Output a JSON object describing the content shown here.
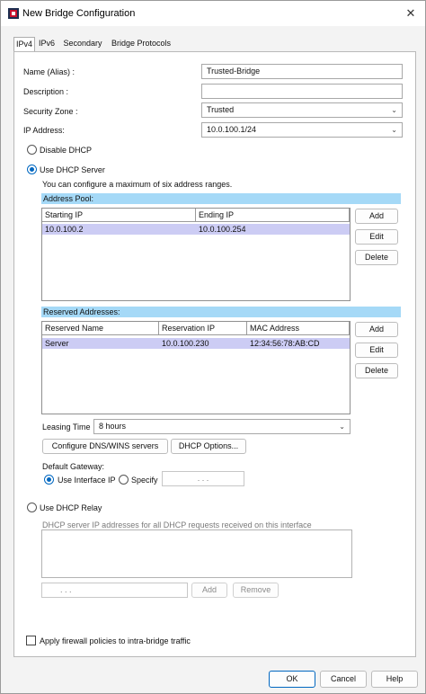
{
  "window": {
    "title": "New Bridge Configuration",
    "close_glyph": "✕"
  },
  "tabs": [
    {
      "label": "IPv4",
      "active": true
    },
    {
      "label": "IPv6",
      "active": false
    },
    {
      "label": "Secondary",
      "active": false
    },
    {
      "label": "Bridge Protocols",
      "active": false
    }
  ],
  "form": {
    "name_label": "Name (Alias) :",
    "name_value": "Trusted-Bridge",
    "description_label": "Description :",
    "description_value": "",
    "zone_label": "Security Zone :",
    "zone_value": "Trusted",
    "ip_label": "IP Address:",
    "ip_value": "10.0.100.1/24"
  },
  "dhcp": {
    "disable_label": "Disable DHCP",
    "server_label": "Use DHCP Server",
    "server_note": "You can configure a maximum of six address ranges.",
    "selected_mode": "server"
  },
  "address_pool": {
    "header": "Address Pool:",
    "columns": [
      "Starting IP",
      "Ending IP"
    ],
    "rows": [
      {
        "start": "10.0.100.2",
        "end": "10.0.100.254"
      }
    ],
    "add_label": "Add",
    "edit_label": "Edit",
    "delete_label": "Delete"
  },
  "reserved": {
    "header": "Reserved Addresses:",
    "columns": [
      "Reserved Name",
      "Reservation IP",
      "MAC Address"
    ],
    "rows": [
      {
        "name": "Server",
        "ip": "10.0.100.230",
        "mac": "12:34:56:78:AB:CD"
      }
    ],
    "add_label": "Add",
    "edit_label": "Edit",
    "delete_label": "Delete"
  },
  "leasing": {
    "label": "Leasing Time",
    "value": "8 hours"
  },
  "config_buttons": {
    "dns_label": "Configure DNS/WINS servers",
    "options_label": "DHCP Options..."
  },
  "gateway": {
    "label": "Default Gateway:",
    "interface_label": "Use Interface IP",
    "specify_label": "Specify",
    "ip_placeholder": ".       .       .",
    "selected": "interface"
  },
  "relay": {
    "label": "Use DHCP Relay",
    "note": "DHCP server IP addresses for all DHCP requests received on this interface",
    "ip_placeholder": ".       .       .",
    "add_label": "Add",
    "remove_label": "Remove"
  },
  "policy": {
    "label": "Apply firewall policies to intra-bridge traffic",
    "checked": false
  },
  "footer": {
    "ok_label": "OK",
    "cancel_label": "Cancel",
    "help_label": "Help"
  },
  "colors": {
    "accent": "#0067c0",
    "section_header": "#a5d9f7",
    "selected_row": "#ccccf4",
    "brand_icon": "#c8102e"
  }
}
